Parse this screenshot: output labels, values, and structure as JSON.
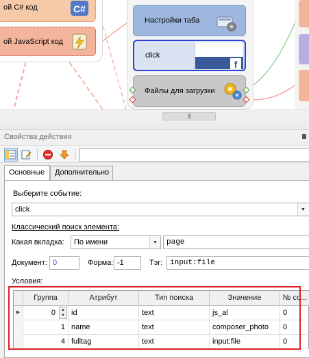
{
  "canvas": {
    "nodes": {
      "csharp": "ой C# код",
      "javascript": "ой JavaScript код",
      "tab_settings": "Настройки таба",
      "click": "click",
      "files": "Файлы для загрузки"
    },
    "scrollbar_grip": "|||"
  },
  "panel": {
    "title": "Свойства действия",
    "tabs": [
      "Основные",
      "Дополнительно"
    ]
  },
  "form": {
    "event_label": "Выберите событие:",
    "event_value": "click",
    "classic_search_label": "Классический поиск элемента:",
    "tab_label": "Какая вкладка:",
    "tab_mode": "По имени",
    "tab_value": "page",
    "document_label": "Документ:",
    "document_value": "0",
    "form_label": "Форма:",
    "form_value": "-1",
    "tag_label": "Тэг:",
    "tag_value": "input:file",
    "conditions_label": "Условия:"
  },
  "grid": {
    "columns": [
      "Группа",
      "Атрибут",
      "Тип поиска",
      "Значение",
      "№ со..."
    ],
    "rows": [
      {
        "group": "0",
        "attribute": "id",
        "search_type": "text",
        "value": "js_al",
        "number": "0"
      },
      {
        "group": "1",
        "attribute": "name",
        "search_type": "text",
        "value": "composer_photo",
        "number": "0"
      },
      {
        "group": "4",
        "attribute": "fulltag",
        "search_type": "text",
        "value": "input:file",
        "number": "0"
      }
    ]
  },
  "colors": {
    "accent_selected": "#2b3fd4",
    "highlight_box": "#e02020",
    "purple_value": "#7b2fbe",
    "facebook": "#3b5998"
  }
}
